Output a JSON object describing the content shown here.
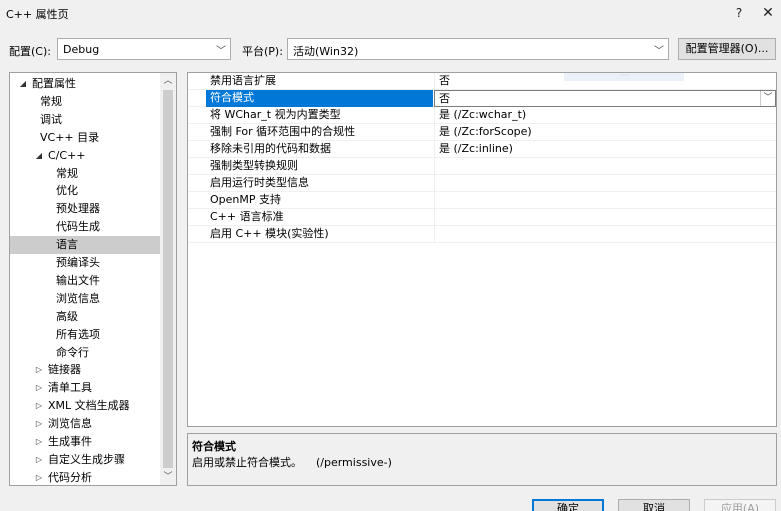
{
  "window": {
    "title": "C++ 属性页",
    "help_glyph": "?",
    "close_glyph": "✕"
  },
  "config": {
    "config_label": "配置(C):",
    "config_value": "Debug",
    "platform_label": "平台(P):",
    "platform_value": "活动(Win32)",
    "manager_label": "配置管理器(O)..."
  },
  "tree": {
    "items": [
      {
        "label": "配置属性",
        "expander": "◢"
      },
      {
        "label": "常规"
      },
      {
        "label": "调试"
      },
      {
        "label": "VC++ 目录"
      },
      {
        "label": "C/C++",
        "expander": "◢"
      },
      {
        "label": "常规"
      },
      {
        "label": "优化"
      },
      {
        "label": "预处理器"
      },
      {
        "label": "代码生成"
      },
      {
        "label": "语言",
        "selected": true
      },
      {
        "label": "预编译头"
      },
      {
        "label": "输出文件"
      },
      {
        "label": "浏览信息"
      },
      {
        "label": "高级"
      },
      {
        "label": "所有选项"
      },
      {
        "label": "命令行"
      },
      {
        "label": "链接器",
        "expander": "▷"
      },
      {
        "label": "清单工具",
        "expander": "▷"
      },
      {
        "label": "XML 文档生成器",
        "expander": "▷"
      },
      {
        "label": "浏览信息",
        "expander": "▷"
      },
      {
        "label": "生成事件",
        "expander": "▷"
      },
      {
        "label": "自定义生成步骤",
        "expander": "▷"
      },
      {
        "label": "代码分析",
        "expander": "▷"
      }
    ]
  },
  "grid": {
    "rows": [
      {
        "name": "禁用语言扩展",
        "value": "否"
      },
      {
        "name": "符合模式",
        "value": "否",
        "selected": true
      },
      {
        "name": "将 WChar_t 视为内置类型",
        "value": "是 (/Zc:wchar_t)"
      },
      {
        "name": "强制 For 循环范围中的合规性",
        "value": "是 (/Zc:forScope)"
      },
      {
        "name": "移除未引用的代码和数据",
        "value": "是 (/Zc:inline)"
      },
      {
        "name": "强制类型转换规则",
        "value": ""
      },
      {
        "name": "启用运行时类型信息",
        "value": ""
      },
      {
        "name": "OpenMP 支持",
        "value": ""
      },
      {
        "name": "C++ 语言标准",
        "value": ""
      },
      {
        "name": "启用 C++ 模块(实验性)",
        "value": ""
      }
    ]
  },
  "description": {
    "title": "符合模式",
    "text": "启用或禁止符合模式。    (/permissive-)"
  },
  "buttons": {
    "ok": "确定",
    "cancel": "取消",
    "apply": "应用(A)"
  }
}
